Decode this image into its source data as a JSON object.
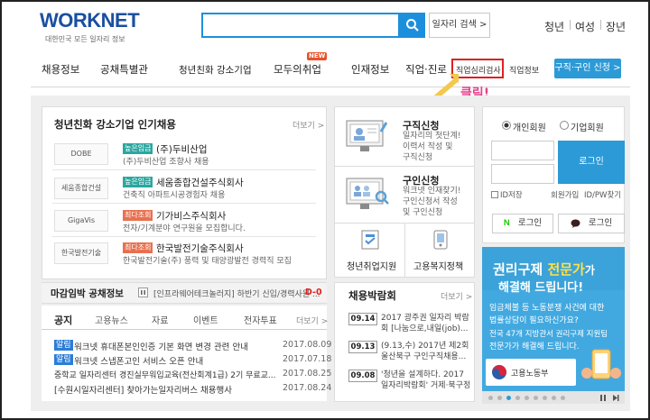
{
  "header": {
    "logo_main": "WORKNET",
    "logo_sub": "대한민국 모든 일자리 정보",
    "search_button": "일자리 검색 >",
    "top_links": [
      "청년",
      "여성",
      "장년"
    ]
  },
  "nav": {
    "items": [
      "채용정보",
      "공채특별관",
      "청년친화 강소기업",
      "모두의취업",
      "인재정보",
      "직업·진로"
    ],
    "new_badge": "NEW",
    "sub_items": [
      "직업심리검사",
      "직업정보"
    ],
    "apply_button": "구직·구인 신청 >",
    "annotation": "클릭!"
  },
  "popular": {
    "title": "청년친화 강소기업 인기채용",
    "more": "더보기 >",
    "companies": [
      {
        "logo": "DOBE",
        "badge": "높은임금",
        "badge_color": "#2aa7a0",
        "name": "(주)두비산업",
        "desc": "(주)두비산업 조향사 채용"
      },
      {
        "logo": "세움종합건설",
        "badge": "높은임금",
        "badge_color": "#2aa7a0",
        "name": "세움종합건설주식회사",
        "desc": "건축직 아파트시공경험자 채용"
      },
      {
        "logo": "GigaVis",
        "badge": "최다조회",
        "badge_color": "#e8704f",
        "name": "기가비스주식회사",
        "desc": "전자/기계분야 연구원을 모집합니다."
      },
      {
        "logo": "한국발전기술",
        "badge": "최다조회",
        "badge_color": "#e8704f",
        "name": "한국발전기술주식회사",
        "desc": "한국발전기술(주) 풍력 및 태양광발전 경력직 모집"
      }
    ]
  },
  "deadline": {
    "title": "마감임박 공채정보",
    "pause_icon": "pause-icon",
    "text": "[인프라웨어테크놀러지] 하반기 신입/경력사원 ...",
    "dday": "D-0"
  },
  "notice": {
    "tabs": [
      "공지",
      "고용뉴스",
      "자료",
      "이벤트",
      "전자투표"
    ],
    "more": "더보기 >",
    "items": [
      {
        "tag": "알림",
        "text": "워크넷 휴대폰본인인증 기본 화면 변경 관련 안내",
        "date": "2017.08.09"
      },
      {
        "tag": "알림",
        "text": "워크넷 스냅폰고인 서비스 오픈 안내",
        "date": "2017.07.18"
      },
      {
        "tag": "",
        "text": "중학교 일자리센터 경진실무워입교육(전산회계1급) 2기 무료교...",
        "date": "2017.08.25"
      },
      {
        "tag": "",
        "text": "[수원시일자리센터] 찾아가는일자리버스 채용행사",
        "date": "2017.08.24"
      }
    ]
  },
  "services": {
    "job_seek": {
      "title": "구직신청",
      "desc": [
        "일자리의 첫단계!",
        "이력서 작성 및",
        "구직신청"
      ]
    },
    "job_offer": {
      "title": "구인신청",
      "desc": [
        "워크넷 인재찾기!",
        "구인신청서 작성",
        "및 구인신청"
      ]
    },
    "youth": "청년취업지원",
    "welfare": "고용복지정책"
  },
  "expo": {
    "title": "채용박람회",
    "more": "더보기 >",
    "items": [
      {
        "date": "09.14",
        "lines": [
          "2017 광주권 일자리 박람",
          "회 [나눔으로,내일(job)..."
        ]
      },
      {
        "date": "09.13",
        "lines": [
          "(9.13,수) 2017년 제2회",
          "울산북구 구인구직채용..."
        ]
      },
      {
        "date": "09.08",
        "lines": [
          "'청년을 설계하다. 2017",
          "일자리박람회' 거제·북구정"
        ]
      }
    ]
  },
  "login": {
    "radio_personal": "개인회원",
    "radio_corp": "기업회원",
    "login_button": "로그인",
    "save_id": "ID저장",
    "join": "회원가입",
    "find": "ID/PW찾기",
    "naver": "로그인",
    "kakao": "로그인"
  },
  "banner": {
    "title_a": "권리구제 ",
    "title_b": "전문가",
    "title_c": "가",
    "title_2": "해결해 드립니다!",
    "lines": [
      "임금체불 등 노동분쟁 사건에 대한",
      "법률상담이 필요하신가요?",
      "전국 47개 지방관서 권리구제 지원팀",
      "전문가가 해결해 드립니다."
    ],
    "org": "고용노동부"
  },
  "colors": {
    "brand_blue": "#1c8fdc",
    "accent_red": "#e02020",
    "arrow_yellow": "#f2c94c",
    "click_pink": "#e8418c"
  }
}
